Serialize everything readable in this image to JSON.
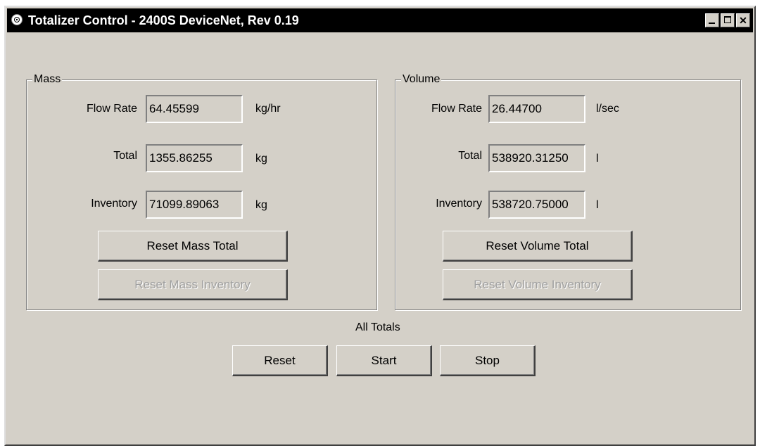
{
  "window": {
    "title": "Totalizer Control - 2400S DeviceNet, Rev 0.19"
  },
  "mass": {
    "group_label": "Mass",
    "flow_rate": {
      "label": "Flow Rate",
      "value": "64.45599",
      "unit": "kg/hr"
    },
    "total": {
      "label": "Total",
      "value": "1355.86255",
      "unit": "kg"
    },
    "inventory": {
      "label": "Inventory",
      "value": "71099.89063",
      "unit": "kg"
    },
    "reset_total_label": "Reset Mass Total",
    "reset_inventory_label": "Reset Mass Inventory"
  },
  "volume": {
    "group_label": "Volume",
    "flow_rate": {
      "label": "Flow Rate",
      "value": "26.44700",
      "unit": "l/sec"
    },
    "total": {
      "label": "Total",
      "value": "538920.31250",
      "unit": "l"
    },
    "inventory": {
      "label": "Inventory",
      "value": "538720.75000",
      "unit": "l"
    },
    "reset_total_label": "Reset Volume Total",
    "reset_inventory_label": "Reset Volume Inventory"
  },
  "all_totals": {
    "label": "All Totals",
    "reset_label": "Reset",
    "start_label": "Start",
    "stop_label": "Stop"
  }
}
